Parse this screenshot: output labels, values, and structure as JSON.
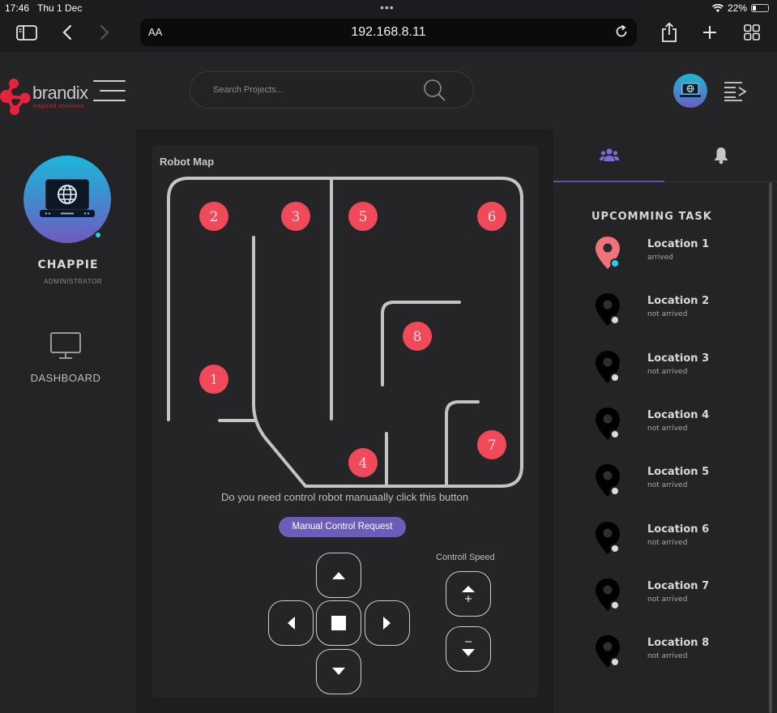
{
  "status_bar": {
    "time": "17:46",
    "date": "Thu 1 Dec",
    "battery": "22%"
  },
  "browser": {
    "text_size_label": "AA",
    "url": "192.168.8.11"
  },
  "app": {
    "brand": {
      "name": "brandix",
      "tagline": "inspired solutions"
    },
    "search": {
      "placeholder": "Search Projects..."
    },
    "profile": {
      "name": "CHAPPIE",
      "role": "ADMINISTRATOR"
    },
    "nav": {
      "dashboard_label": "DASHBOARD"
    },
    "map": {
      "title": "Robot Map",
      "markers": [
        {
          "id": "1",
          "label": "1"
        },
        {
          "id": "2",
          "label": "2"
        },
        {
          "id": "3",
          "label": "3"
        },
        {
          "id": "4",
          "label": "4"
        },
        {
          "id": "5",
          "label": "5"
        },
        {
          "id": "6",
          "label": "6"
        },
        {
          "id": "7",
          "label": "7"
        },
        {
          "id": "8",
          "label": "8"
        }
      ],
      "marker_color": "#f04a5a"
    },
    "manual": {
      "prompt": "Do you need control robot manuaally click this button",
      "button_label": "Manual Control Request"
    },
    "speed": {
      "label": "Controll  Speed"
    },
    "tasks": {
      "title": "UPCOMMING TASK",
      "items": [
        {
          "name": "Location 1",
          "status": "arrived",
          "state": "arrived"
        },
        {
          "name": "Location 2",
          "status": "not arrived",
          "state": "pending"
        },
        {
          "name": "Location 3",
          "status": "not arrived",
          "state": "pending"
        },
        {
          "name": "Location 4",
          "status": "not arrived",
          "state": "pending"
        },
        {
          "name": "Location 5",
          "status": "not arrived",
          "state": "pending"
        },
        {
          "name": "Location 6",
          "status": "not arrived",
          "state": "pending"
        },
        {
          "name": "Location 7",
          "status": "not arrived",
          "state": "pending"
        },
        {
          "name": "Location 8",
          "status": "not arrived",
          "state": "pending"
        }
      ]
    },
    "colors": {
      "accent": "#6d5db8",
      "arrived_pin": "#f0727a",
      "online_dot": "#1ed3f0"
    }
  }
}
